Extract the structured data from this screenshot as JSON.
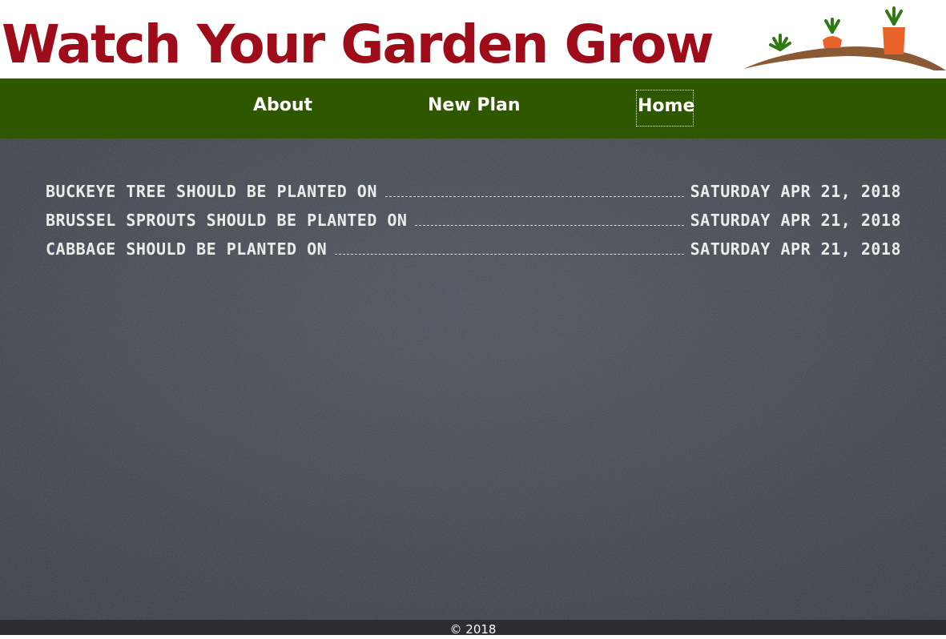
{
  "header": {
    "title": "Watch Your Garden Grow",
    "logo_icon": "carrots-in-soil-icon"
  },
  "nav": {
    "items": [
      {
        "label": "About"
      },
      {
        "label": "New Plan"
      },
      {
        "label": "Home",
        "active": true
      }
    ]
  },
  "plans": [
    {
      "label": "Buckeye Tree should be planted on",
      "date": "Saturday Apr 21, 2018"
    },
    {
      "label": "Brussel Sprouts should be planted on",
      "date": "Saturday Apr 21, 2018"
    },
    {
      "label": "Cabbage should be planted on",
      "date": "Saturday Apr 21, 2018"
    }
  ],
  "footer": {
    "copyright": "© 2018"
  },
  "colors": {
    "title": "#9e0c1a",
    "nav_bg": "#2f5700",
    "slate_bg": "#3f454e",
    "chalk": "#e9ece8",
    "footer_bg": "#2b2d31"
  }
}
